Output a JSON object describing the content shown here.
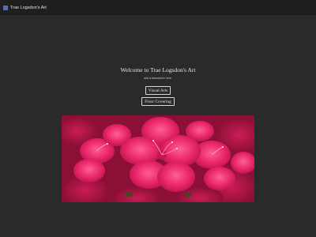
{
  "header": {
    "brand_label": "Trae Logsdon's Art",
    "brand_icon": "logo-icon"
  },
  "main": {
    "title": "Welcome to Trae Logsdon's Art",
    "subtitle": "add a description here.",
    "buttons": [
      {
        "label": "Visual Arts"
      },
      {
        "label": "Floor Covering"
      }
    ]
  },
  "hero": {
    "subject": "pink azalea flowers"
  },
  "colors": {
    "background": "#2a2a2a",
    "topbar": "#1f1f1f",
    "text": "#e6e6e6",
    "flower_pink": "#e8256a",
    "flower_dark": "#8c1035"
  }
}
